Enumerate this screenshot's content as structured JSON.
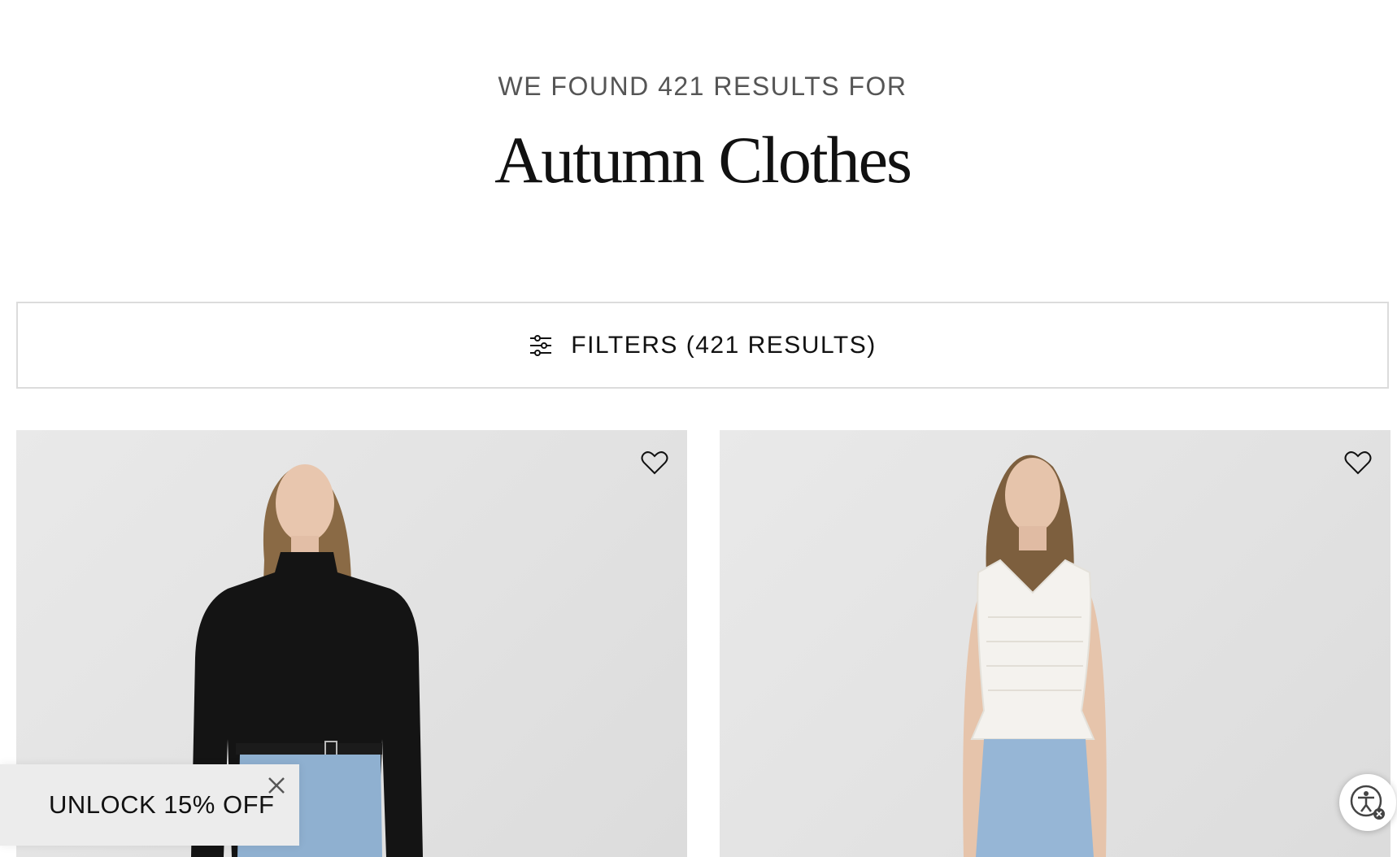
{
  "search": {
    "results_heading": "WE FOUND 421 RESULTS FOR",
    "query_title": "Autumn Clothes"
  },
  "filters": {
    "label": "FILTERS (421 RESULTS)",
    "icon": "sliders-icon"
  },
  "products": [
    {
      "image": "model-black-ribbed-mock-neck-sweater",
      "wishlist_icon": "heart-icon"
    },
    {
      "image": "model-white-smocked-sleeveless-top",
      "wishlist_icon": "heart-icon"
    }
  ],
  "promo": {
    "text": "UNLOCK 15% OFF",
    "close_icon": "close-icon"
  },
  "accessibility": {
    "icon": "accessibility-icon"
  },
  "colors": {
    "background": "#ffffff",
    "text": "#111111",
    "muted_text": "#555555",
    "border": "#dcdcdc",
    "card_bg": "#e4e4e4",
    "promo_bg": "#ececec"
  }
}
